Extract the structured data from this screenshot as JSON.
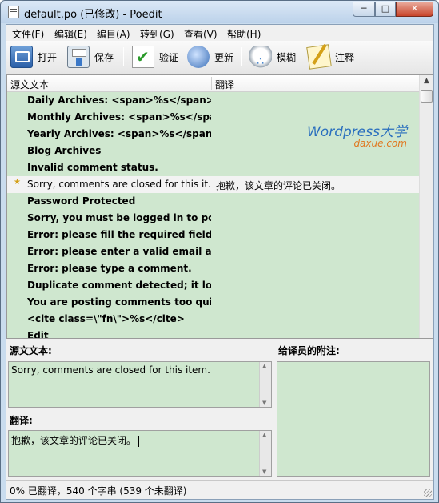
{
  "window": {
    "title": "default.po (已修改) - Poedit",
    "controls": {
      "minimize": "─",
      "maximize": "□",
      "close": "✕"
    }
  },
  "menu": [
    "文件(F)",
    "编辑(E)",
    "编目(A)",
    "转到(G)",
    "查看(V)",
    "帮助(H)"
  ],
  "toolbar": {
    "open": "打开",
    "save": "保存",
    "validate": "验证",
    "update": "更新",
    "fuzzy": "模糊",
    "comment": "注释"
  },
  "list": {
    "headers": {
      "source": "源文文本",
      "translation": "翻译"
    },
    "rows": [
      {
        "source": "Daily Archives: <span>%s</span>",
        "translation": ""
      },
      {
        "source": "Monthly Archives: <span>%s</spa...",
        "translation": ""
      },
      {
        "source": "Yearly Archives: <span>%s</span>",
        "translation": ""
      },
      {
        "source": "Blog Archives",
        "translation": ""
      },
      {
        "source": "Invalid comment status.",
        "translation": ""
      },
      {
        "source": "Sorry, comments are closed for this it...",
        "translation": "抱歉，该文章的评论已关闭。"
      },
      {
        "source": "Password Protected",
        "translation": ""
      },
      {
        "source": "Sorry, you must be logged in to po...",
        "translation": ""
      },
      {
        "source": "Error: please fill the required fields ...",
        "translation": ""
      },
      {
        "source": "Error: please enter a valid email ad...",
        "translation": ""
      },
      {
        "source": "Error: please type a comment.",
        "translation": ""
      },
      {
        "source": "Duplicate comment detected; it loo...",
        "translation": ""
      },
      {
        "source": "You are posting comments too qui...",
        "translation": ""
      },
      {
        "source": "<cite class=\\\"fn\\\">%s</cite>",
        "translation": ""
      },
      {
        "source": "Edit",
        "translation": ""
      }
    ],
    "selected_marker": "★"
  },
  "watermark": {
    "line1": "Wordpress大学",
    "line2": "daxue.com"
  },
  "editor": {
    "source_label": "源文文本:",
    "source_text": "Sorry, comments are closed for this item.",
    "notes_label": "给译员的附注:",
    "translation_label": "翻译:",
    "translation_text": "抱歉，该文章的评论已关闭。"
  },
  "status": "0% 已翻译，540 个字串 (539 个未翻译)"
}
